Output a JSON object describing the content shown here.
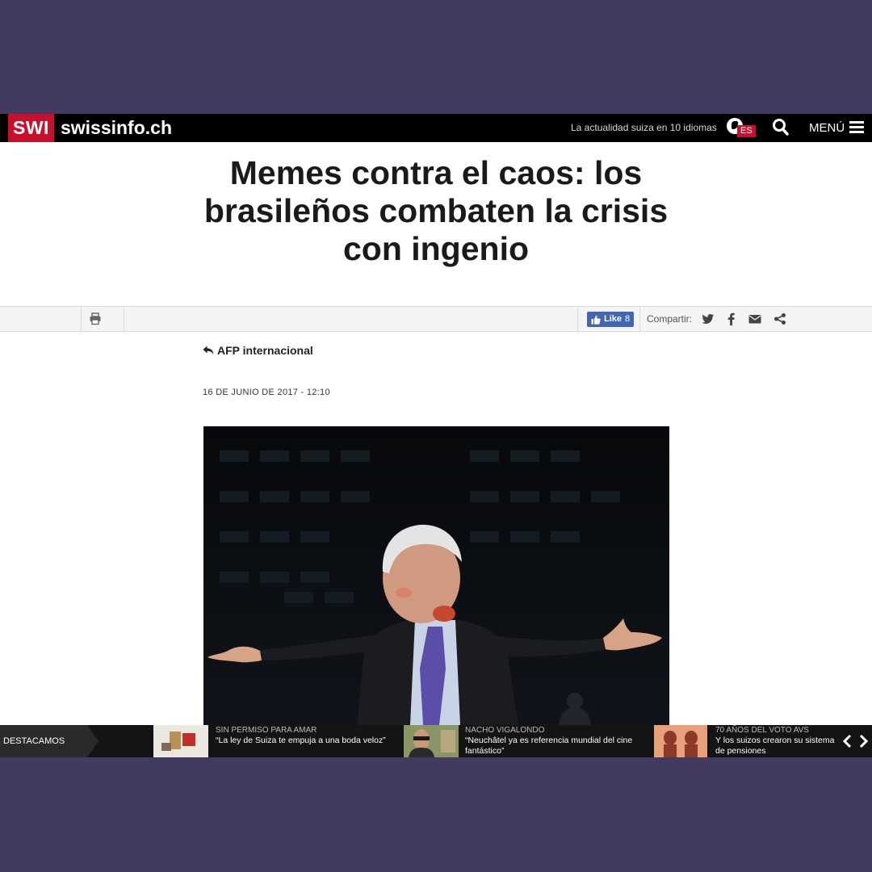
{
  "header": {
    "logo_swi": "SWI",
    "logo_name": "swissinfo.ch",
    "tagline": "La actualidad suiza en 10 idiomas",
    "language_code": "ES",
    "menu_label": "MENÚ"
  },
  "article": {
    "headline": "Memes contra el caos: los brasileños combaten la crisis con ingenio",
    "source": "AFP internacional",
    "date": "16 DE JUNIO DE 2017 - 12:10"
  },
  "toolbar": {
    "like_label": "Like",
    "like_count": "8",
    "share_label": "Compartir:"
  },
  "featured": {
    "label": "DESTACAMOS",
    "items": [
      {
        "kicker": "SIN PERMISO PARA AMAR",
        "title": "“La ley de Suiza te empuja a una boda veloz”"
      },
      {
        "kicker": "NACHO VIGALONDO",
        "title": "“Neuchâtel ya es referencia mundial del cine fantástico”"
      },
      {
        "kicker": "70 AÑOS DEL VOTO AVS",
        "title": "Y los suizos crearon su sistema de pensiones"
      }
    ]
  },
  "colors": {
    "brand_red": "#c8102e",
    "facebook_blue": "#4267b2",
    "backdrop": "#433b5f"
  }
}
